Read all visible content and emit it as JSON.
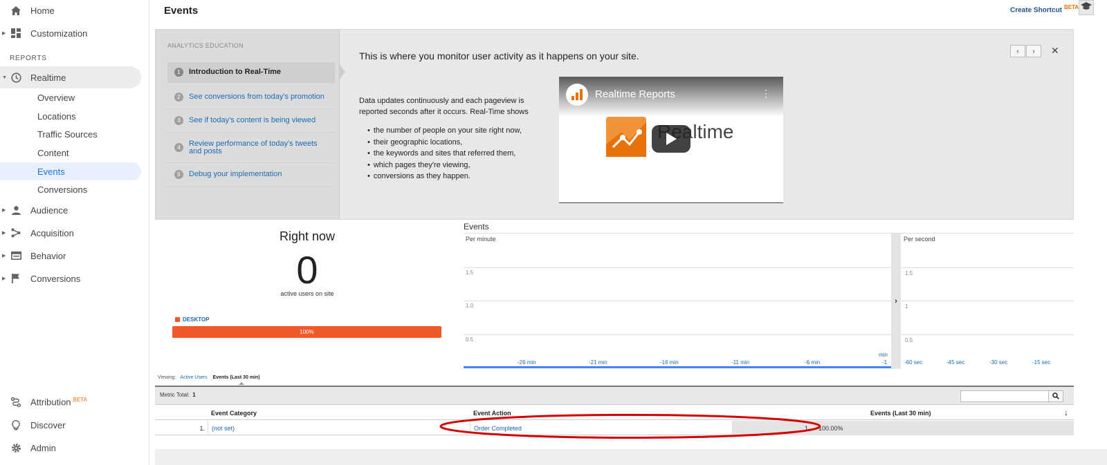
{
  "sidebar": {
    "home": "Home",
    "customization": "Customization",
    "reports_header": "REPORTS",
    "realtime": "Realtime",
    "realtime_items": [
      "Overview",
      "Locations",
      "Traffic Sources",
      "Content",
      "Events",
      "Conversions"
    ],
    "audience": "Audience",
    "acquisition": "Acquisition",
    "behavior": "Behavior",
    "conversions": "Conversions",
    "attribution": "Attribution",
    "attribution_badge": "BETA",
    "discover": "Discover",
    "admin": "Admin"
  },
  "header": {
    "title": "Events",
    "create_shortcut": "Create Shortcut",
    "shortcut_badge": "BETA"
  },
  "education": {
    "label": "ANALYTICS EDUCATION",
    "steps": [
      {
        "num": "1",
        "text": "Introduction to Real-Time"
      },
      {
        "num": "2",
        "text": "See conversions from today's promotion"
      },
      {
        "num": "3",
        "text": "See if today's content is being viewed"
      },
      {
        "num": "4",
        "text": "Review performance of today's tweets and posts"
      },
      {
        "num": "5",
        "text": "Debug your implementation"
      }
    ],
    "heading": "This is where you monitor user activity as it happens on your site.",
    "body": "Data updates continuously and each pageview is reported seconds after it occurs. Real-Time shows",
    "bullets": [
      "the number of people on your site right now,",
      "their geographic locations,",
      "the keywords and sites that referred them,",
      "which pages they're viewing,",
      "conversions as they happen."
    ],
    "video_title": "Realtime Reports",
    "video_brand": "Realtime",
    "close_glyph": "✕",
    "prev_glyph": "‹",
    "next_glyph": "›"
  },
  "right_now": {
    "title": "Right now",
    "value": "0",
    "caption": "active users on site",
    "legend": "DESKTOP",
    "bar_label": "100%",
    "bar_fraction": 1.0,
    "bar_color": "#ef5a28"
  },
  "events_chart": {
    "title": "Events",
    "per_minute": {
      "label": "Per minute",
      "y_ticks": [
        "1.5",
        "1.0",
        "0.5"
      ],
      "x_ticks": [
        "-26 min",
        "-21 min",
        "-16 min",
        "-11 min",
        "-6 min"
      ],
      "x_last_unit": "min",
      "x_last": "-1"
    },
    "per_second": {
      "label": "Per second",
      "y_ticks": [
        "1.5",
        "1",
        "0.5"
      ],
      "x_ticks": [
        "-60 sec",
        "-45 sec",
        "-30 sec",
        "-15 sec"
      ]
    },
    "expand_glyph": "›"
  },
  "viewing": {
    "label": "Viewing:",
    "active_users": "Active Users",
    "events": "Events (Last 30 min)"
  },
  "table": {
    "metric_total_label": "Metric Total:",
    "metric_total_value": "1",
    "columns": [
      "Event Category",
      "Event Action",
      "Events (Last 30 min)"
    ],
    "sort_glyph": "↓",
    "rows": [
      {
        "index": "1.",
        "category": "(not set)",
        "action": "Order Completed",
        "events": "1",
        "percent": "100.00%"
      }
    ]
  },
  "colors": {
    "accent": "#1a6ab6",
    "desktop": "#ef5a28",
    "annotation": "#d40000"
  }
}
